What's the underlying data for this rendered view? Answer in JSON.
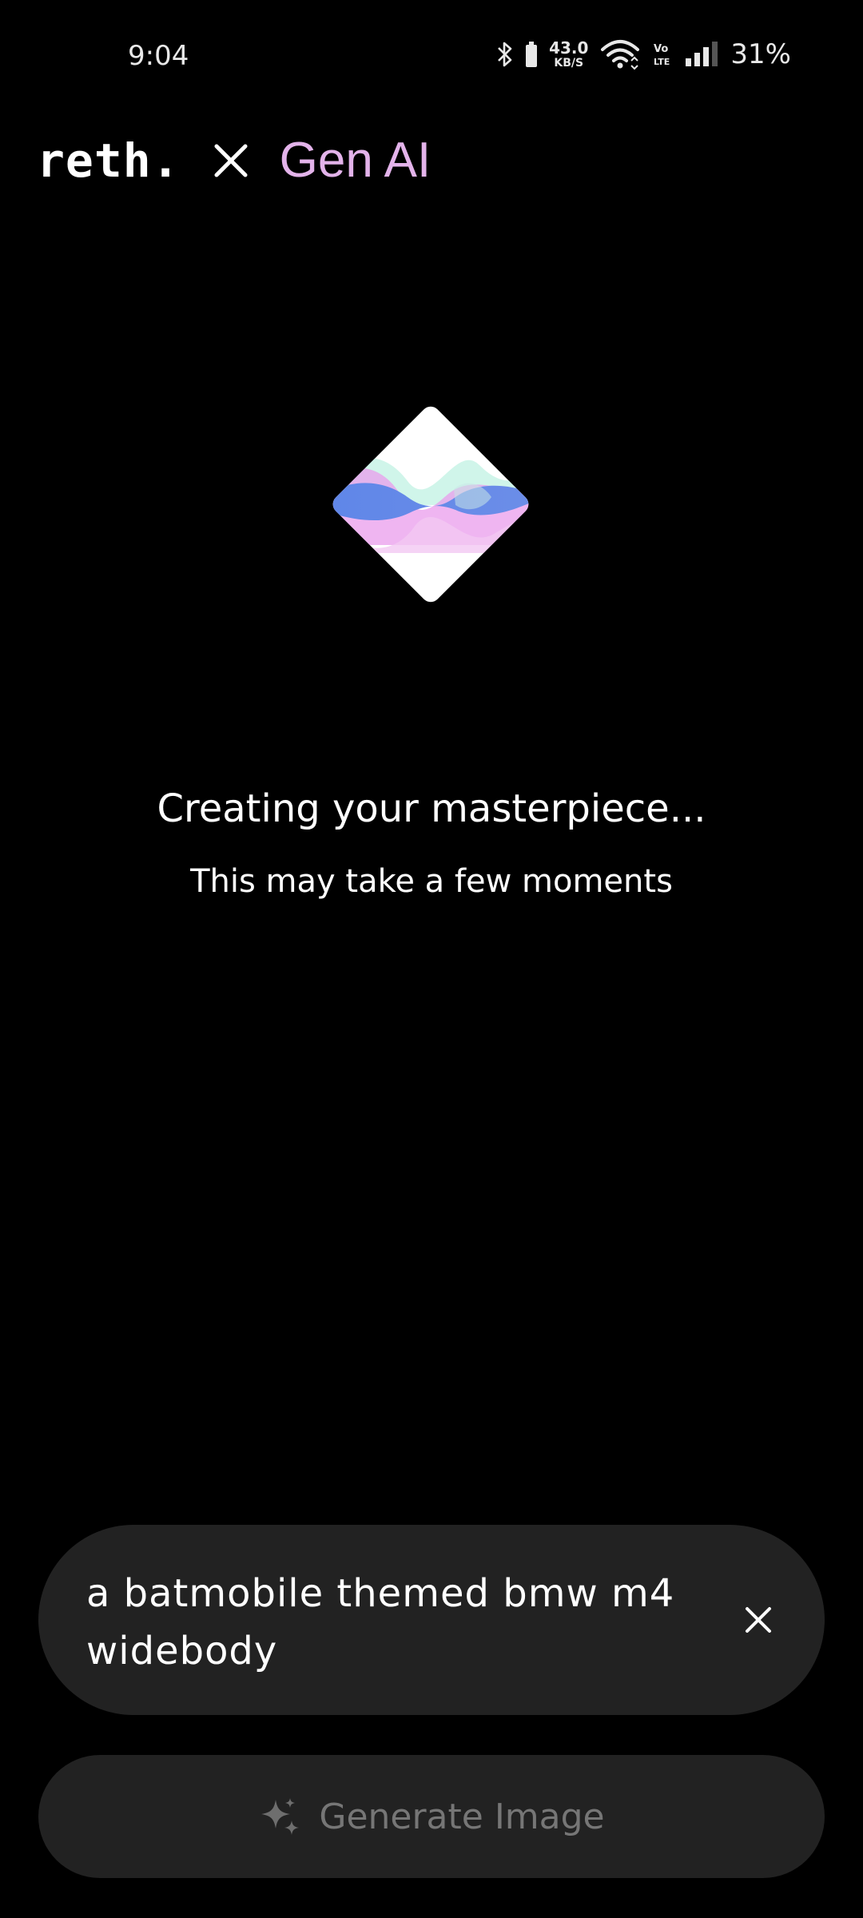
{
  "status_bar": {
    "time": "9:04",
    "net_speed_value": "43.0",
    "net_speed_unit": "KB/S",
    "battery_percent": "31%",
    "icons": [
      "bluetooth-icon",
      "battery-icon",
      "wifi-icon",
      "volte-icon",
      "signal-icon"
    ]
  },
  "header": {
    "brand": "reth.",
    "separator_icon": "close-x-icon",
    "product": "Gen AI"
  },
  "loader": {
    "icon": "ai-wave-diamond-icon"
  },
  "status": {
    "title": "Creating your masterpiece...",
    "subtitle": "This may take a few moments"
  },
  "prompt": {
    "text": "a batmobile themed bmw m4 widebody",
    "clear_icon": "close-icon"
  },
  "generate": {
    "label": "Generate Image",
    "icon": "sparkle-icon"
  },
  "colors": {
    "background": "#000000",
    "accent": "#e3b3ea",
    "surface": "#222222",
    "disabled_text": "#767676"
  }
}
